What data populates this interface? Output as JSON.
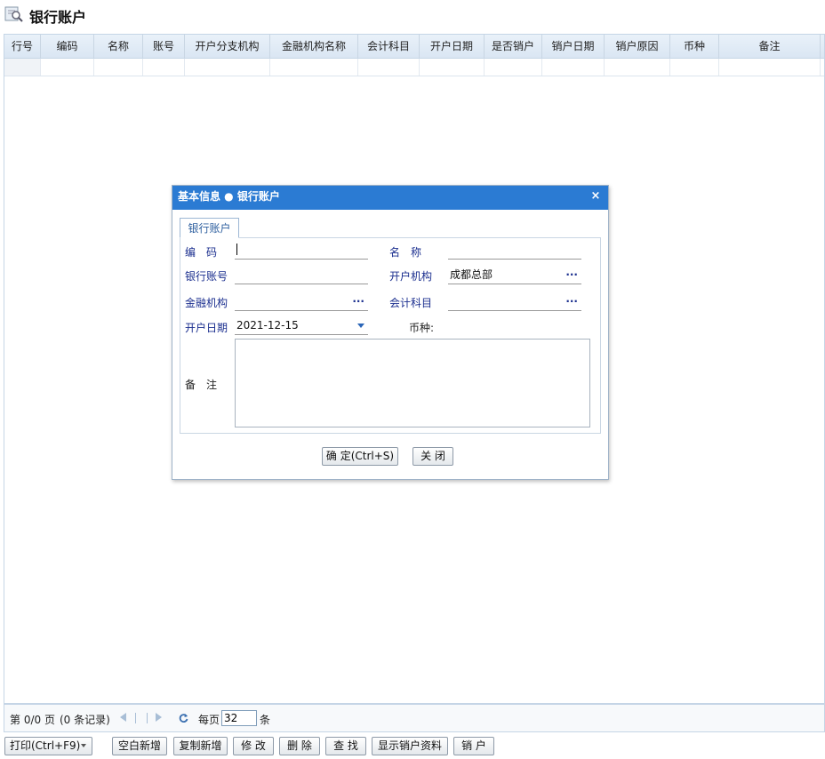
{
  "page": {
    "title": "银行账户",
    "title_icon": "search-doc-icon"
  },
  "grid": {
    "columns": [
      "行号",
      "编码",
      "名称",
      "账号",
      "开户分支机构",
      "金融机构名称",
      "会计科目",
      "开户日期",
      "是否销户",
      "销户日期",
      "销户原因",
      "币种",
      "备注"
    ],
    "rows": []
  },
  "pager": {
    "page_text": "第 0/0 页",
    "records_text": "(0 条记录)",
    "refresh_icon": "refresh-icon",
    "per_page_label": "每页",
    "per_page_value": "32",
    "per_page_unit": "条"
  },
  "toolbar": {
    "print": "打印(Ctrl+F9)",
    "new_blank": "空白新增",
    "copy_new": "复制新增",
    "edit": "修 改",
    "delete": "删 除",
    "find": "查 找",
    "show_closed": "显示销户资料",
    "close_account": "销 户"
  },
  "dialog": {
    "title": "基本信息 ● 银行账户",
    "close_icon": "close-icon",
    "tab_label": "银行账户",
    "fields": {
      "code_label": "编　码",
      "code_value": "",
      "name_label": "名　称",
      "name_value": "",
      "account_label": "银行账号",
      "account_value": "",
      "branch_label": "开户机构",
      "branch_value": "成都总部",
      "bank_label": "金融机构",
      "bank_value": "",
      "subject_label": "会计科目",
      "subject_value": "",
      "open_date_label": "开户日期",
      "open_date_value": "2021-12-15",
      "currency_label": "币种:",
      "remark_label": "备　注",
      "remark_value": ""
    },
    "ok_button": "确 定(Ctrl+S)",
    "close_button": "关 闭"
  },
  "colors": {
    "dialog_title_bg": "#2b7bd3",
    "label_blue": "#1b2f8f",
    "grid_header_bg": "#dae6f3"
  }
}
